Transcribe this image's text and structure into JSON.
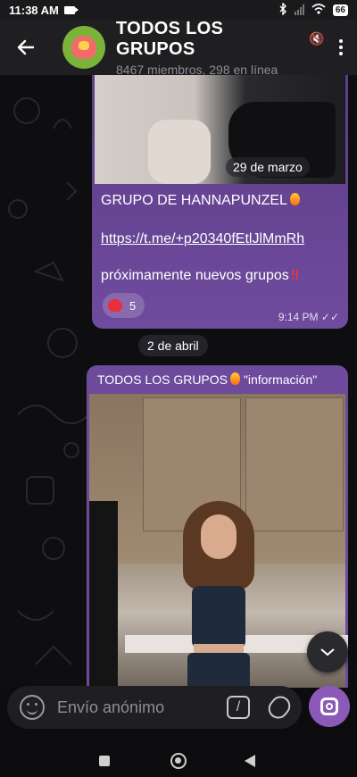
{
  "statusbar": {
    "time": "11:38 AM",
    "battery": "66"
  },
  "header": {
    "title": "TODOS LOS GRUPOS",
    "subtitle": "8467 miembros, 298 en línea"
  },
  "messages": [
    {
      "date_chip": "29 de marzo",
      "title": "GRUPO DE HANNAPUNZEL",
      "link": "https://t.me/+p20340fEtlJlMmRh",
      "text": "próximamente nuevos grupos",
      "reaction_count": "5",
      "time": "9:14 PM"
    }
  ],
  "date_separator": "2 de abril",
  "message2": {
    "header_prefix": "TODOS LOS GRUPOS",
    "header_suffix": "\"información\""
  },
  "composer": {
    "placeholder": "Envío anónimo"
  },
  "colors": {
    "bubble": "#6d4a9c",
    "accent": "#8b5ab8"
  }
}
